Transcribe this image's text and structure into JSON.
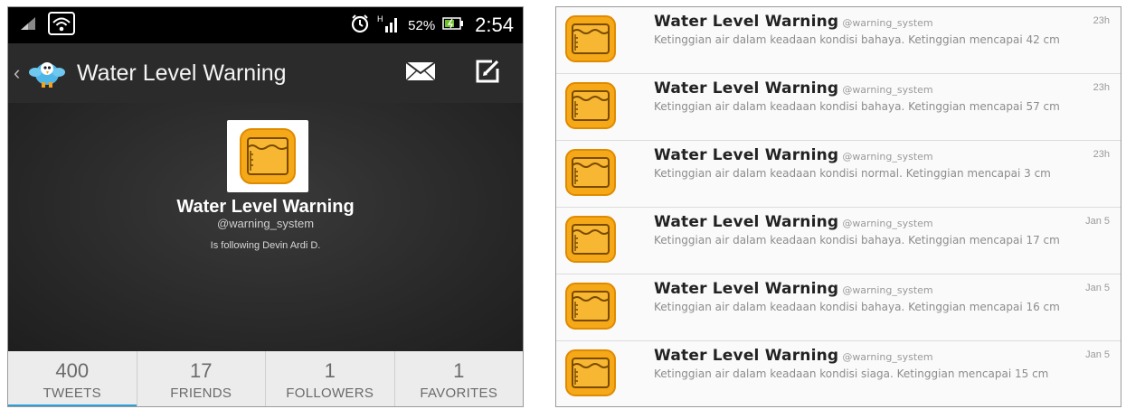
{
  "status_bar": {
    "battery": "52%",
    "time": "2:54"
  },
  "action_bar": {
    "title": "Water Level Warning"
  },
  "profile": {
    "name": "Water Level Warning",
    "handle": "@warning_system",
    "following": "Is following Devin Ardi D."
  },
  "stats": [
    {
      "number": "400",
      "label": "TWEETS"
    },
    {
      "number": "17",
      "label": "FRIENDS"
    },
    {
      "number": "1",
      "label": "FOLLOWERS"
    },
    {
      "number": "1",
      "label": "FAVORITES"
    }
  ],
  "tweets": [
    {
      "name": "Water Level Warning",
      "handle": "@warning_system",
      "time": "23h",
      "text": "Ketinggian air dalam keadaan kondisi bahaya. Ketinggian mencapai 42 cm"
    },
    {
      "name": "Water Level Warning",
      "handle": "@warning_system",
      "time": "23h",
      "text": "Ketinggian air dalam keadaan kondisi bahaya. Ketinggian mencapai 57 cm"
    },
    {
      "name": "Water Level Warning",
      "handle": "@warning_system",
      "time": "23h",
      "text": "Ketinggian air dalam keadaan kondisi normal. Ketinggian mencapai 3 cm"
    },
    {
      "name": "Water Level Warning",
      "handle": "@warning_system",
      "time": "Jan 5",
      "text": "Ketinggian air dalam keadaan kondisi bahaya. Ketinggian mencapai 17 cm"
    },
    {
      "name": "Water Level Warning",
      "handle": "@warning_system",
      "time": "Jan 5",
      "text": "Ketinggian air dalam keadaan kondisi bahaya. Ketinggian mencapai 16 cm"
    },
    {
      "name": "Water Level Warning",
      "handle": "@warning_system",
      "time": "Jan 5",
      "text": "Ketinggian air dalam keadaan kondisi siaga. Ketinggian mencapai 15 cm"
    }
  ],
  "colors": {
    "accent": "#2f9fd6",
    "app_icon": "#f5a818"
  }
}
